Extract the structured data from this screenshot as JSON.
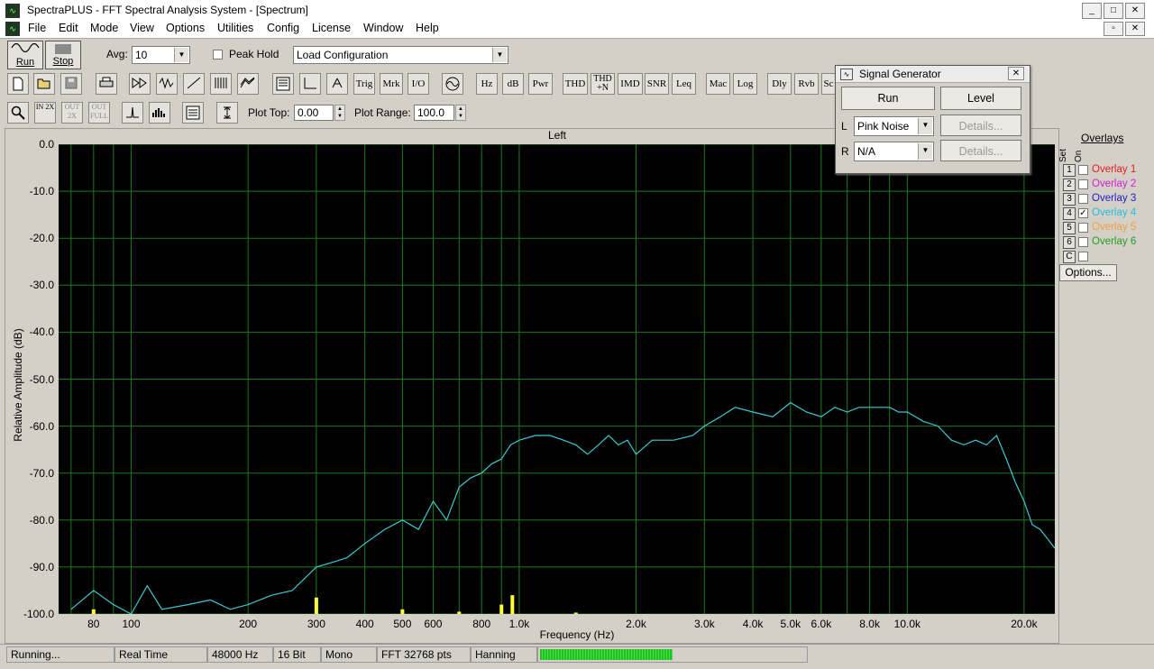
{
  "window": {
    "title": "SpectraPLUS - FFT Spectral Analysis System - [Spectrum]",
    "menu": [
      "File",
      "Edit",
      "Mode",
      "View",
      "Options",
      "Utilities",
      "Config",
      "License",
      "Window",
      "Help"
    ]
  },
  "toolbar1": {
    "run_label": "Run",
    "stop_label": "Stop",
    "avg_label": "Avg:",
    "avg_value": "10",
    "peak_hold_label": "Peak Hold",
    "peak_hold_checked": false,
    "config_value": "Load Configuration"
  },
  "toolbar2": {
    "text_buttons": [
      "Trig",
      "Mrk",
      "I/O",
      "Hz",
      "dB",
      "Pwr",
      "THD",
      "THD+N",
      "IMD",
      "SNR",
      "Leq",
      "Mac",
      "Log",
      "Dly",
      "Rvb",
      "Sc"
    ]
  },
  "toolbar3": {
    "plot_top_label": "Plot Top:",
    "plot_top_value": "0.00",
    "plot_range_label": "Plot Range:",
    "plot_range_value": "100.0",
    "zoom_in_label": "IN 2X",
    "zoom_out_label": "OUT 2X",
    "zoom_full_label": "OUT FULL"
  },
  "plot": {
    "channel_title": "Left",
    "ylabel": "Relative Amplitude (dB)",
    "xlabel": "Frequency (Hz)",
    "y_ticks": [
      "0.0",
      "-10.0",
      "-20.0",
      "-30.0",
      "-40.0",
      "-50.0",
      "-60.0",
      "-70.0",
      "-80.0",
      "-90.0",
      "-100.0"
    ],
    "x_ticks": [
      "80",
      "100",
      "200",
      "300",
      "400",
      "500",
      "600",
      "800",
      "1.0k",
      "2.0k",
      "3.0k",
      "4.0k",
      "5.0k",
      "6.0k",
      "8.0k",
      "10.0k",
      "20.0k"
    ],
    "colors": {
      "background": "#000000",
      "grid": "#1a7a1a",
      "trace": "#3ec8d0",
      "markers": "#ffff33"
    }
  },
  "chart_data": {
    "type": "line",
    "title": "Left",
    "xlabel": "Frequency (Hz)",
    "ylabel": "Relative Amplitude (dB)",
    "xscale": "log",
    "xlim": [
      65,
      24000
    ],
    "ylim": [
      -100,
      0
    ],
    "grid": true,
    "x": [
      70,
      80,
      90,
      100,
      110,
      120,
      140,
      160,
      180,
      200,
      230,
      260,
      300,
      330,
      360,
      400,
      450,
      500,
      550,
      600,
      650,
      700,
      750,
      800,
      850,
      900,
      950,
      1000,
      1100,
      1200,
      1300,
      1400,
      1500,
      1600,
      1700,
      1800,
      1900,
      2000,
      2200,
      2500,
      2800,
      3000,
      3300,
      3600,
      4000,
      4500,
      5000,
      5500,
      6000,
      6500,
      7000,
      7500,
      8000,
      8500,
      9000,
      9500,
      10000,
      11000,
      12000,
      13000,
      14000,
      15000,
      16000,
      17000,
      18000,
      19000,
      20000,
      21000,
      22000,
      23000,
      24000
    ],
    "y": [
      -99,
      -95,
      -98,
      -100,
      -94,
      -99,
      -98,
      -97,
      -99,
      -98,
      -96,
      -95,
      -90,
      -89,
      -88,
      -85,
      -82,
      -80,
      -82,
      -76,
      -80,
      -73,
      -71,
      -70,
      -68,
      -67,
      -64,
      -63,
      -62,
      -62,
      -63,
      -64,
      -66,
      -64,
      -62,
      -64,
      -63,
      -66,
      -63,
      -63,
      -62,
      -60,
      -58,
      -56,
      -57,
      -58,
      -55,
      -57,
      -58,
      -56,
      -57,
      -56,
      -56,
      -56,
      -56,
      -57,
      -57,
      -59,
      -60,
      -63,
      -64,
      -63,
      -64,
      -62,
      -67,
      -72,
      -76,
      -81,
      -82,
      -84,
      -86
    ],
    "markers": [
      {
        "x": 80,
        "y": -99
      },
      {
        "x": 300,
        "y": -96.5
      },
      {
        "x": 500,
        "y": -99
      },
      {
        "x": 700,
        "y": -99.5
      },
      {
        "x": 900,
        "y": -98
      },
      {
        "x": 960,
        "y": -96
      },
      {
        "x": 1400,
        "y": -99.7
      }
    ]
  },
  "overlays": {
    "header": "Overlays",
    "set_label": "Set",
    "on_label": "On",
    "items": [
      {
        "num": "1",
        "label": "Overlay 1",
        "color": "#e02020",
        "checked": false
      },
      {
        "num": "2",
        "label": "Overlay 2",
        "color": "#d020d0",
        "checked": false
      },
      {
        "num": "3",
        "label": "Overlay 3",
        "color": "#2020c0",
        "checked": false
      },
      {
        "num": "4",
        "label": "Overlay 4",
        "color": "#20c0e0",
        "checked": true
      },
      {
        "num": "5",
        "label": "Overlay 5",
        "color": "#f0a040",
        "checked": false
      },
      {
        "num": "6",
        "label": "Overlay 6",
        "color": "#20a020",
        "checked": false
      },
      {
        "num": "C",
        "label": "",
        "color": "#888888",
        "checked": false
      }
    ],
    "options_label": "Options..."
  },
  "signal_generator": {
    "title": "Signal Generator",
    "run_label": "Run",
    "level_label": "Level",
    "l_label": "L",
    "l_value": "Pink Noise",
    "r_label": "R",
    "r_value": "N/A",
    "details_label": "Details..."
  },
  "status": {
    "state": "Running...",
    "mode": "Real Time",
    "rate": "48000 Hz",
    "bits": "16 Bit",
    "channels": "Mono",
    "fft": "FFT 32768 pts",
    "window": "Hanning",
    "progress": 0.5
  }
}
